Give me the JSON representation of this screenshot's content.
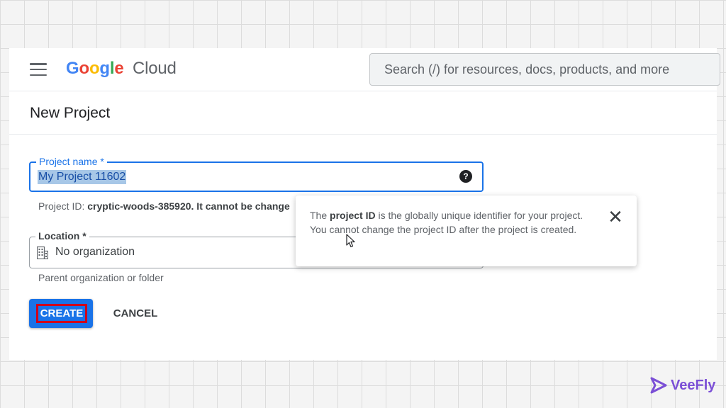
{
  "header": {
    "logo_google": "Google",
    "logo_cloud": "Cloud",
    "search_placeholder": "Search (/) for resources, docs, products, and more"
  },
  "page": {
    "title": "New Project"
  },
  "form": {
    "project_name": {
      "label": "Project name *",
      "value": "My Project 11602",
      "hint_prefix": "Project ID: ",
      "hint_id": "cryptic-woods-385920.",
      "hint_suffix": " It cannot be change"
    },
    "location": {
      "label": "Location *",
      "value": "No organization",
      "hint": "Parent organization or folder"
    },
    "create_label": "CREATE",
    "cancel_label": "CANCEL"
  },
  "tooltip": {
    "text_before": "The ",
    "text_bold": "project ID",
    "text_after": " is the globally unique identifier for your project. You cannot change the project ID after the project is created."
  },
  "watermark": {
    "name": "VeeFly"
  },
  "colors": {
    "primary": "#1a73e8",
    "highlight_border": "#d0021b",
    "brand": "#7b4fd6"
  },
  "icons": {
    "menu": "hamburger-menu-icon",
    "help": "question-circle-icon",
    "org": "building-icon",
    "close": "close-x-icon"
  }
}
